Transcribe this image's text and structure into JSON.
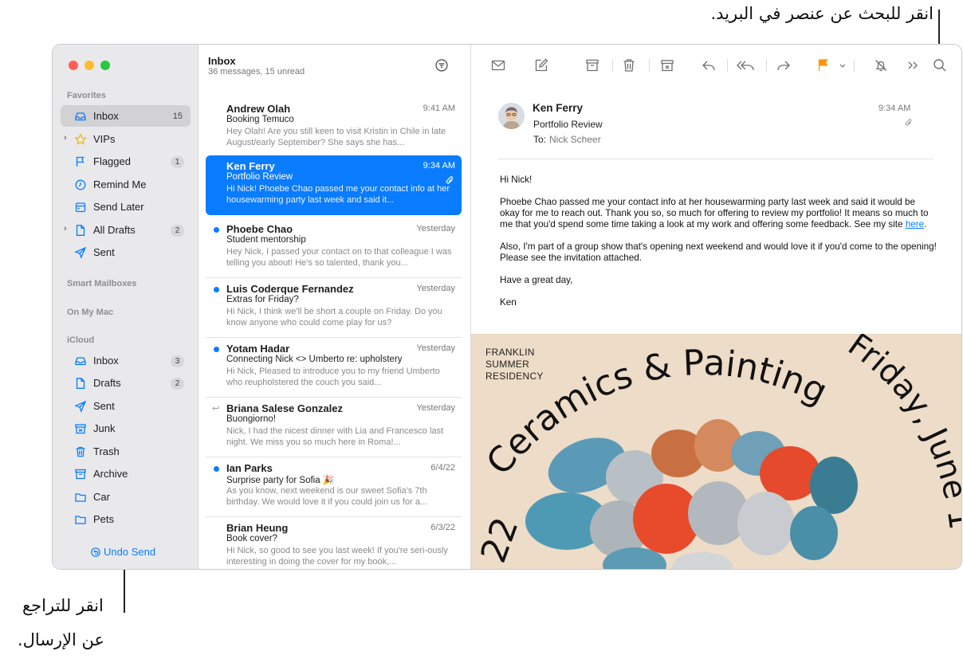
{
  "annotations": {
    "search": "انقر للبحث عن عنصر في البريد.",
    "undo_line1": "انقر للتراجع",
    "undo_line2": "عن الإرسال."
  },
  "colors": {
    "accent": "#0a7cff",
    "flag": "#ff9500",
    "sidebar_bg": "#e9e9eb"
  },
  "sidebar": {
    "favorites_header": "Favorites",
    "favorites": [
      {
        "label": "Inbox",
        "icon": "tray-icon",
        "badge": "15"
      },
      {
        "label": "VIPs",
        "icon": "star-icon",
        "badge": ""
      },
      {
        "label": "Flagged",
        "icon": "flag-icon",
        "badge": "1"
      },
      {
        "label": "Remind Me",
        "icon": "clock-icon",
        "badge": ""
      },
      {
        "label": "Send Later",
        "icon": "calendar-icon",
        "badge": ""
      },
      {
        "label": "All Drafts",
        "icon": "document-icon",
        "badge": "2"
      },
      {
        "label": "Sent",
        "icon": "paperplane-icon",
        "badge": ""
      }
    ],
    "smart_header": "Smart Mailboxes",
    "mac_header": "On My Mac",
    "icloud_header": "iCloud",
    "icloud": [
      {
        "label": "Inbox",
        "icon": "tray-icon",
        "badge": "3"
      },
      {
        "label": "Drafts",
        "icon": "document-icon",
        "badge": "2"
      },
      {
        "label": "Sent",
        "icon": "paperplane-icon",
        "badge": ""
      },
      {
        "label": "Junk",
        "icon": "junk-icon",
        "badge": ""
      },
      {
        "label": "Trash",
        "icon": "trash-icon",
        "badge": ""
      },
      {
        "label": "Archive",
        "icon": "archive-icon",
        "badge": ""
      },
      {
        "label": "Car",
        "icon": "folder-icon",
        "badge": ""
      },
      {
        "label": "Pets",
        "icon": "folder-icon",
        "badge": ""
      }
    ],
    "undo_send": "Undo Send"
  },
  "list": {
    "title": "Inbox",
    "subtitle": "36 messages, 15 unread",
    "messages": [
      {
        "from": "Andrew Olah",
        "time": "9:41 AM",
        "subject": "Booking Temuco",
        "preview": "Hey Olah! Are you still keen to visit Kristin in Chile in late August/early September? She says she has..."
      },
      {
        "from": "Ken Ferry",
        "time": "9:34 AM",
        "subject": "Portfolio Review",
        "preview": "Hi Nick! Phoebe Chao passed me your contact info at her housewarming party last week and said it..."
      },
      {
        "from": "Phoebe Chao",
        "time": "Yesterday",
        "subject": "Student mentorship",
        "preview": "Hey Nick, I passed your contact on to that colleague I was telling you about! He's so talented, thank you..."
      },
      {
        "from": "Luis Coderque Fernandez",
        "time": "Yesterday",
        "subject": "Extras for Friday?",
        "preview": "Hi Nick, I think we'll be short a couple on Friday. Do you know anyone who could come play for us?"
      },
      {
        "from": "Yotam Hadar",
        "time": "Yesterday",
        "subject": "Connecting Nick <> Umberto re: upholstery",
        "preview": "Hi Nick, Pleased to introduce you to my friend Umberto who reupholstered the couch you said..."
      },
      {
        "from": "Briana Salese Gonzalez",
        "time": "Yesterday",
        "subject": "Buongiorno!",
        "preview": "Nick, I had the nicest dinner with Lia and Francesco last night. We miss you so much here in Roma!..."
      },
      {
        "from": "Ian Parks",
        "time": "6/4/22",
        "subject": "Surprise party for Sofia 🎉",
        "preview": "As you know, next weekend is our sweet Sofia's 7th birthday. We would love it if you could join us for a..."
      },
      {
        "from": "Brian Heung",
        "time": "6/3/22",
        "subject": "Book cover?",
        "preview": "Hi Nick, so good to see you last week! If you're seri-ously interesting in doing the cover for my book,..."
      }
    ]
  },
  "reader": {
    "from": "Ken Ferry",
    "subject": "Portfolio Review",
    "to_label": "To:",
    "to_name": "Nick Scheer",
    "time": "9:34 AM",
    "greeting": "Hi Nick!",
    "para1": "Phoebe Chao passed me your contact info at her housewarming party last week and said it would be okay for me to reach out. Thank you so, so much for offering to review my portfolio! It means so much to me that you'd spend some time taking a look at my work and offering some feedback. See my site ",
    "link": "here",
    "para2": "Also, I'm part of a group show that's opening next weekend and would love it if you'd come to the opening! Please see the invitation attached.",
    "closing": "Have a great day,",
    "signature": "Ken",
    "poster": {
      "residency": [
        "FRANKLIN",
        "SUMMER",
        "RESIDENCY"
      ],
      "arc_text": "Ceramics & Painting",
      "date_text": "Friday, June 1",
      "year_text": "22"
    }
  }
}
